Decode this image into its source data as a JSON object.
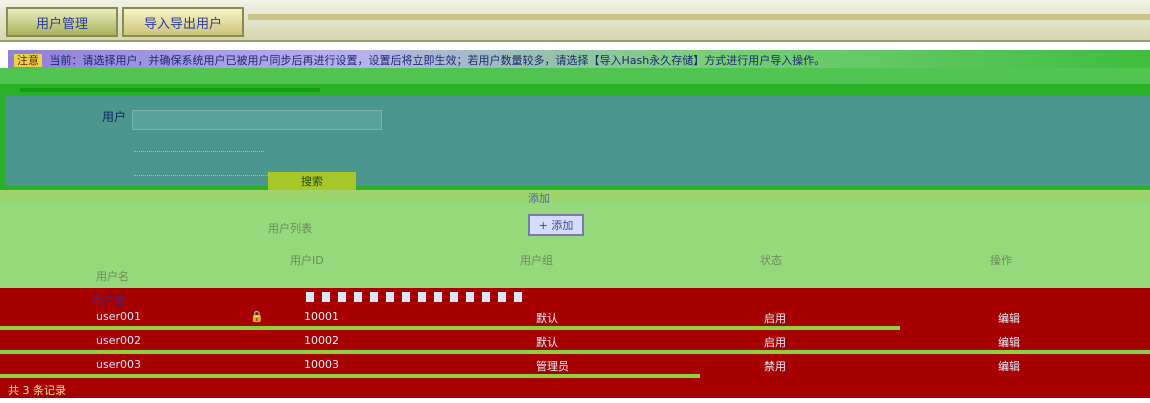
{
  "tabs": [
    {
      "label": "用户管理",
      "active": true
    },
    {
      "label": "导入导出用户",
      "active": false
    }
  ],
  "notice": {
    "tag": "注意",
    "text": "当前：请选择用户，并确保系统用户已被用户同步后再进行设置，设置后将立即生效；若用户数量较多，请选择【导入Hash永久存储】方式进行用户导入操作。"
  },
  "search": {
    "label": "用户",
    "placeholder": "",
    "button_label": "搜索"
  },
  "toolbar": {
    "icon_label": "添加",
    "add_button_label": "+ 添加",
    "left_label": "用户列表"
  },
  "table": {
    "headers": [
      "用户名",
      "用户ID",
      "用户组",
      "状态",
      "操作"
    ],
    "head_user": "用户名",
    "rows": [
      {
        "name": "user001",
        "id": "10001",
        "group": "默认",
        "status": "启用",
        "action": "编辑"
      },
      {
        "name": "user002",
        "id": "10002",
        "group": "默认",
        "status": "启用",
        "action": "编辑"
      },
      {
        "name": "user003",
        "id": "10003",
        "group": "管理员",
        "status": "禁用",
        "action": "编辑"
      }
    ],
    "footer": "共 3 条记录"
  },
  "colors": {
    "accent": "#2a3a9a",
    "panel": "#4c978d",
    "row_bg": "#a60000",
    "table_bg": "#96d97c"
  },
  "icons": [
    "user-tab-icon",
    "import-tab-icon",
    "add-icon",
    "lock-icon"
  ]
}
